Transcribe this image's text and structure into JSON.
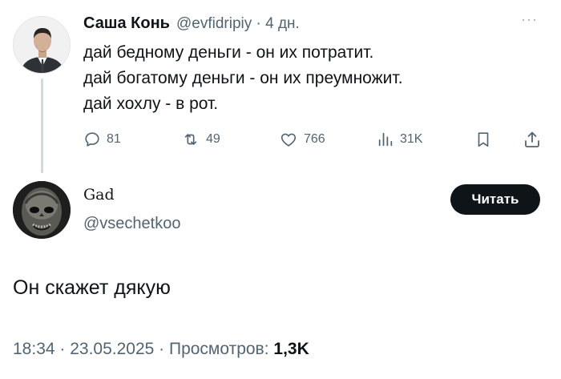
{
  "parent_tweet": {
    "author_name": "Саша Конь",
    "handle_time": "@evfidripiy · 4 дн.",
    "more": "···",
    "lines": [
      "дай бедному деньги - он их потратит.",
      "дай богатому деньги - он их преумножит.",
      "дай хохлу - в рот."
    ],
    "actions": {
      "replies": "81",
      "retweets": "49",
      "likes": "766",
      "views": "31K"
    }
  },
  "reply_tweet": {
    "author_name": "Gad",
    "handle": "@vsechetkoo",
    "follow_label": "Читать",
    "text": "Он скажет дякую",
    "time_date": "18:34 · 23.05.2025 · Просмотров: ",
    "views": "1,3K"
  },
  "colors": {
    "text": "#0f1419",
    "secondary": "#536471",
    "thread_line": "#cfd9de",
    "follow_bg": "#0f1419"
  },
  "icons": [
    "reply-icon",
    "retweet-icon",
    "like-icon",
    "views-icon",
    "bookmark-icon",
    "share-icon",
    "more-icon"
  ]
}
